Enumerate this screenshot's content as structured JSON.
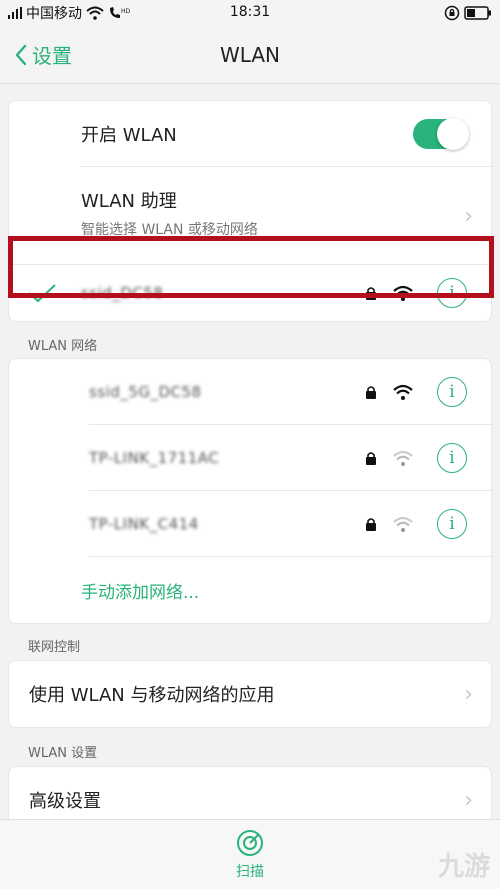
{
  "status_bar": {
    "carrier": "中国移动",
    "time": "18:31"
  },
  "nav": {
    "back_label": "设置",
    "title": "WLAN"
  },
  "wlan_card": {
    "toggle_label": "开启 WLAN",
    "toggle_on": true,
    "assistant_title": "WLAN 助理",
    "assistant_subtitle": "智能选择 WLAN 或移动网络",
    "connected_network": "ssid_DC58"
  },
  "networks_section": {
    "header": "WLAN 网络",
    "networks": [
      {
        "name": "ssid_5G_DC58"
      },
      {
        "name": "TP-LINK_1711AC"
      },
      {
        "name": "TP-LINK_C414"
      }
    ],
    "add_network": "手动添加网络..."
  },
  "network_control": {
    "header": "联网控制",
    "apps_label": "使用 WLAN 与移动网络的应用"
  },
  "wlan_settings": {
    "header": "WLAN 设置",
    "advanced_label": "高级设置"
  },
  "bottom_bar": {
    "scan_label": "扫描"
  },
  "watermark": "九游",
  "colors": {
    "accent": "#2ab27b",
    "highlight": "#b30f1c"
  }
}
